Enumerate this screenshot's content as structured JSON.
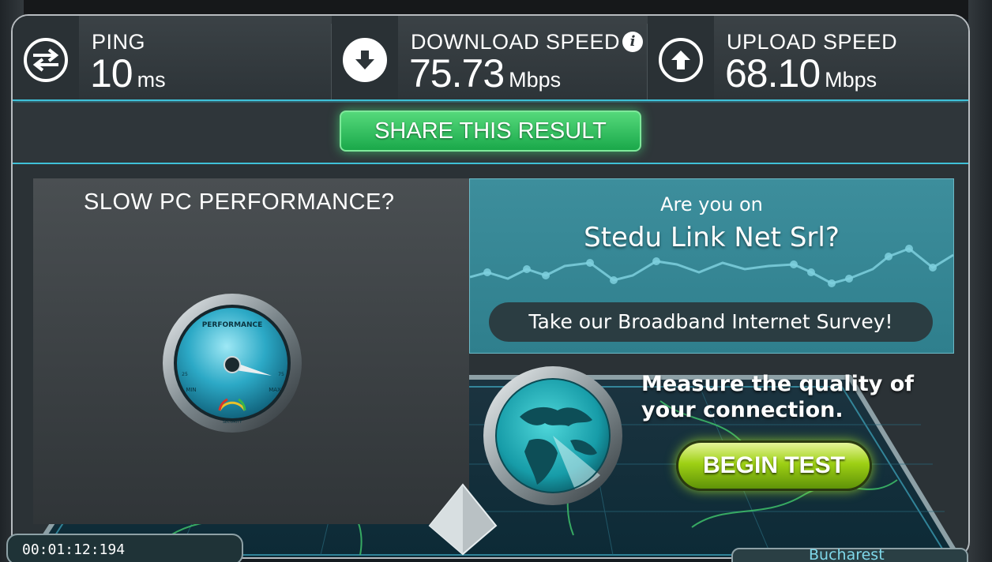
{
  "stats": {
    "ping": {
      "label": "PING",
      "value": "10",
      "unit": "ms",
      "icon": "ping-arrows-icon"
    },
    "download": {
      "label": "DOWNLOAD SPEED",
      "value": "75.73",
      "unit": "Mbps",
      "icon": "download-arrow-icon"
    },
    "upload": {
      "label": "UPLOAD SPEED",
      "value": "68.10",
      "unit": "Mbps",
      "icon": "upload-arrow-icon"
    }
  },
  "info_glyph": "i",
  "share_label": "SHARE THIS RESULT",
  "promo": {
    "title": "SLOW PC PERFORMANCE?",
    "gauge_title": "PERFORMANCE",
    "gauge_min": "MIN",
    "gauge_max": "MAX",
    "gauge_bottom": "SECURITY",
    "gauge_tick_left": "25",
    "gauge_tick_right": "75"
  },
  "survey": {
    "line1": "Are you on",
    "line2": "Stedu Link Net Srl?",
    "button": "Take our Broadband Internet Survey!"
  },
  "measure": {
    "text": "Measure the quality of your connection.",
    "button": "BEGIN TEST"
  },
  "footer": {
    "left_text": "00:01:12:194",
    "right_text": "Bucharest"
  },
  "colors": {
    "accent_cyan": "#3fc1d8",
    "share_green": "#1aa84a",
    "begin_green": "#9ed014"
  }
}
